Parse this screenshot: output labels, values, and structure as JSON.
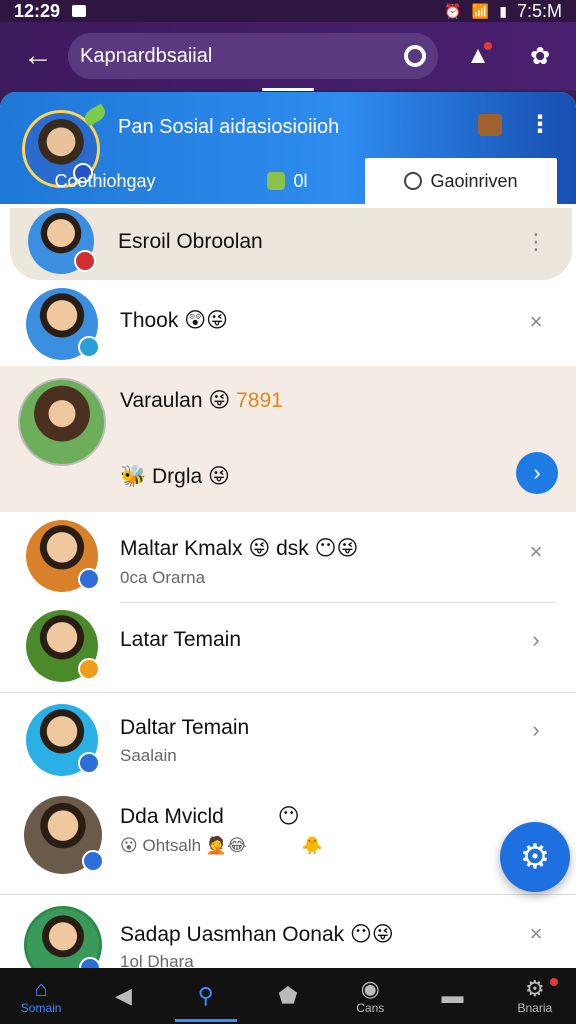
{
  "status_bar": {
    "time": "12:29",
    "clock_right": "7:5:M"
  },
  "app_bar": {
    "search_text": "Kapnardbsaiial"
  },
  "header": {
    "title": "Pan Sosial aidasiosioiioh"
  },
  "tabs": [
    {
      "label": "Coothiohgay"
    },
    {
      "label": "0l"
    },
    {
      "label": "Gaoinriven"
    }
  ],
  "rows": [
    {
      "name": "Esroil Obroolan",
      "sub": "",
      "action": "⋮"
    },
    {
      "name": "Thook",
      "emoji": "😲😜",
      "sub": "",
      "action": "×"
    },
    {
      "name": "Varaulan",
      "emoji": "😜",
      "accent": "7891",
      "sub_emoji": "🐝",
      "sub": "Drgla",
      "sub_emoji2": "😜",
      "action": "›"
    },
    {
      "name": "Maltar Kmalx",
      "emoji": "😜",
      "name2": "dsk",
      "emoji2": "😶😜",
      "sub": "0ca Orarna",
      "action": "×"
    },
    {
      "name": "Latar Temain",
      "sub": "",
      "action": "›"
    },
    {
      "name": "Daltar Temain",
      "sub": "Saalain",
      "action": "›"
    },
    {
      "name": "Dda Mvicld",
      "emoji": "😶",
      "sub": "Ohtsalh",
      "sub_emoji": "😮",
      "sub_emoji2": "🤦😂",
      "sub_emoji3": "🐥",
      "action": ""
    },
    {
      "name": "Sadap Uasmhan Oonak",
      "emoji": "😶😜",
      "sub": "1ol Dhara",
      "action": "×"
    }
  ],
  "bottom_nav": [
    {
      "label": "Somain",
      "icon": "home-icon"
    },
    {
      "label": "",
      "icon": "back-triangle-icon"
    },
    {
      "label": "",
      "icon": "search-icon"
    },
    {
      "label": "",
      "icon": "pentagon-icon"
    },
    {
      "label": "Cans",
      "icon": "eye-icon"
    },
    {
      "label": "",
      "icon": "chat-icon"
    },
    {
      "label": "Bnaria",
      "icon": "gear-icon"
    }
  ]
}
